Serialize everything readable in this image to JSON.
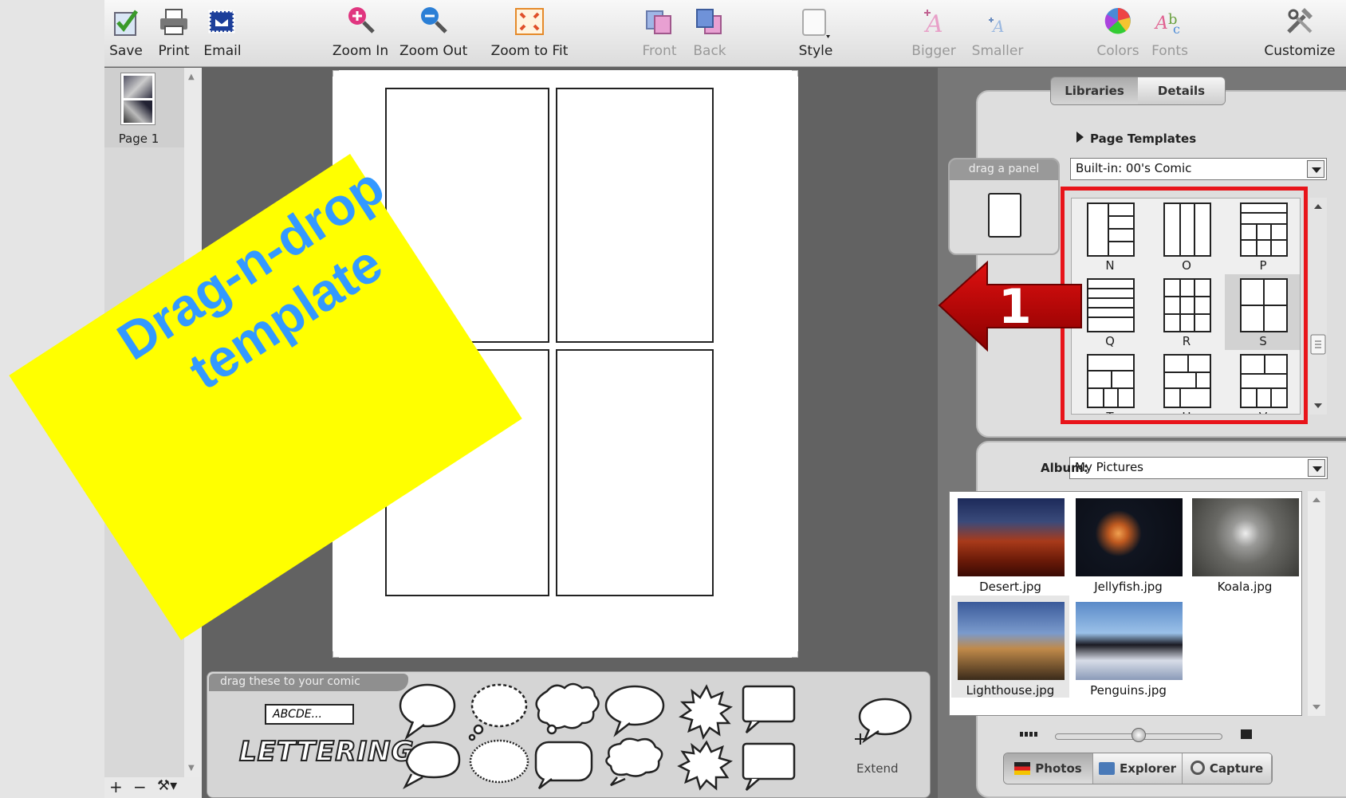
{
  "toolbar": {
    "save": "Save",
    "print": "Print",
    "email": "Email",
    "zoom_in": "Zoom In",
    "zoom_out": "Zoom Out",
    "zoom_fit": "Zoom to Fit",
    "front": "Front",
    "back": "Back",
    "style": "Style",
    "bigger": "Bigger",
    "smaller": "Smaller",
    "colors": "Colors",
    "fonts": "Fonts",
    "customize": "Customize"
  },
  "pages": {
    "thumb_label": "Page 1",
    "add": "+",
    "remove": "−",
    "tools": "⚒▾"
  },
  "palette": {
    "tab": "drag these to your comic",
    "caption_sample": "ABCDE...",
    "lettering": "LETTERING",
    "extend": "Extend"
  },
  "library": {
    "tabs": [
      "Libraries",
      "Details"
    ],
    "section": "Page Templates",
    "drag_panel": "drag a panel",
    "set_select": "Built-in: 00's Comic",
    "templates": [
      "N",
      "O",
      "P",
      "Q",
      "R",
      "S",
      "T",
      "U",
      "V"
    ],
    "album_label": "Album:",
    "album_select": "My Pictures",
    "photos": [
      "Desert.jpg",
      "Jellyfish.jpg",
      "Koala.jpg",
      "Lighthouse.jpg",
      "Penguins.jpg"
    ],
    "bottom_tabs": [
      "Photos",
      "Explorer",
      "Capture"
    ]
  },
  "annotation": {
    "callout": "Drag-n-drop template",
    "step": "1",
    "highlight_color": "#e8141a",
    "arrow_color": "#c80000",
    "sticker_color": "#ffff00",
    "text_color": "#3399ff"
  }
}
